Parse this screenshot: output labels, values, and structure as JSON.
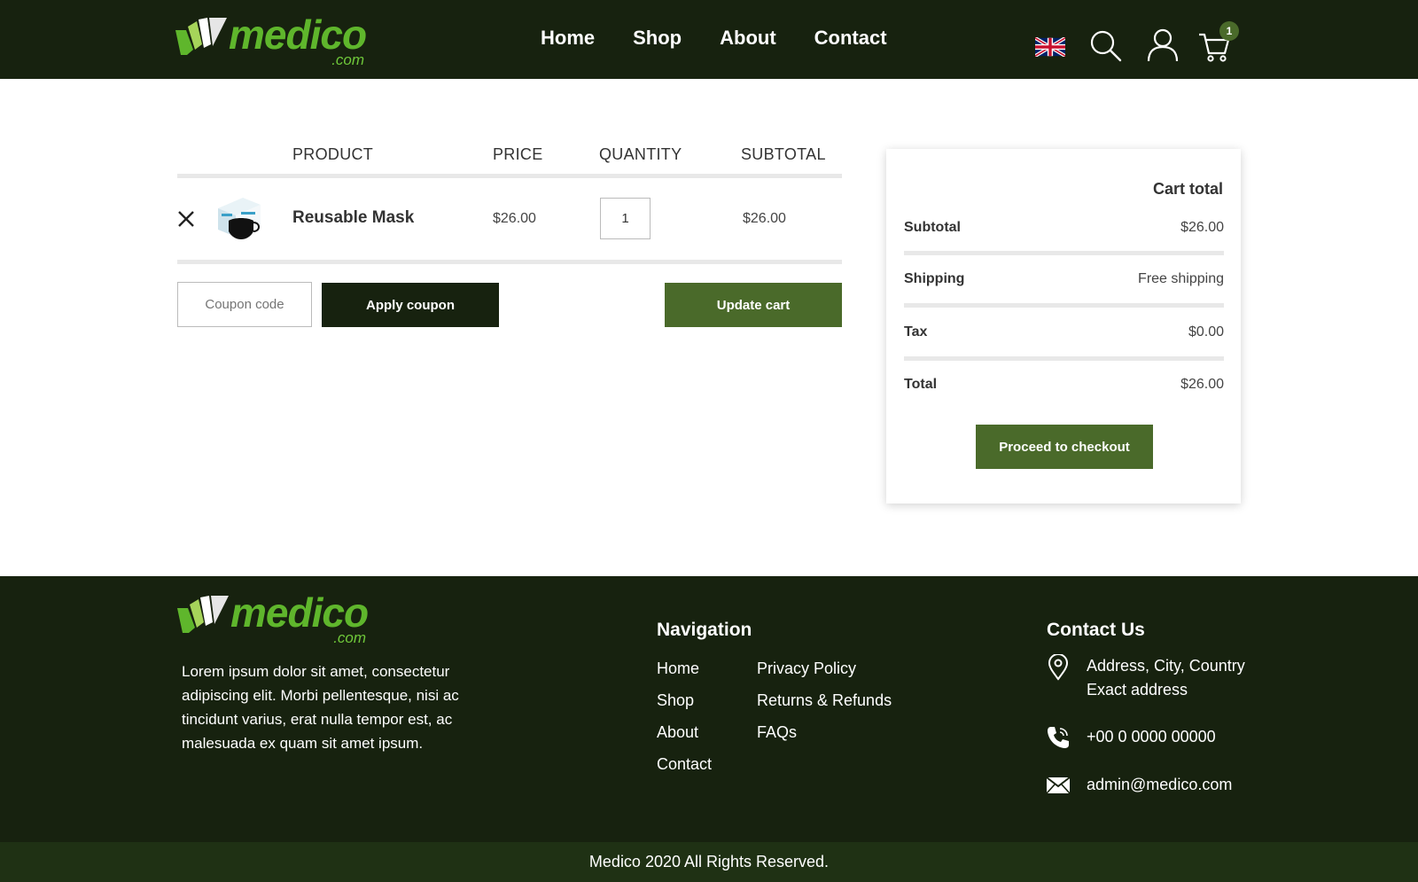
{
  "brand": {
    "word": "medico",
    "suffix": ".com"
  },
  "header": {
    "nav": [
      {
        "label": "Home"
      },
      {
        "label": "Shop"
      },
      {
        "label": "About"
      },
      {
        "label": "Contact"
      }
    ],
    "icons": [
      "uk-flag-icon",
      "search-icon",
      "user-icon",
      "cart-icon"
    ],
    "cart_count": "1"
  },
  "cart": {
    "columns": {
      "product": "PRODUCT",
      "price": "PRICE",
      "quantity": "QUANTITY",
      "subtotal": "SUBTOTAL"
    },
    "items": [
      {
        "name": "Reusable Mask",
        "price": "$26.00",
        "quantity": "1",
        "subtotal": "$26.00"
      }
    ],
    "coupon_placeholder": "Coupon code",
    "apply_label": "Apply coupon",
    "update_label": "Update cart"
  },
  "totals": {
    "title": "Cart total",
    "rows": [
      {
        "label": "Subtotal",
        "value": "$26.00"
      },
      {
        "label": "Shipping",
        "value": "Free shipping"
      },
      {
        "label": "Tax",
        "value": "$0.00"
      },
      {
        "label": "Total",
        "value": "$26.00"
      }
    ],
    "checkout_label": "Proceed to checkout"
  },
  "footer": {
    "about": "Lorem ipsum dolor sit amet, consectetur adipiscing elit. Morbi pellentesque, nisi ac tincidunt varius, erat nulla tempor est, ac malesuada ex quam sit amet ipsum.",
    "nav_title": "Navigation",
    "nav_col1": [
      "Home",
      "Shop",
      "About",
      "Contact"
    ],
    "nav_col2": [
      "Privacy Policy",
      "Returns & Refunds",
      "FAQs"
    ],
    "contact_title": "Contact Us",
    "address_line1": "Address, City, Country",
    "address_line2": "Exact address",
    "phone": "+00 0 0000 00000",
    "email": "admin@medico.com",
    "copyright": "Medico 2020 All Rights Reserved."
  },
  "colors": {
    "header_bg": "#17220f",
    "accent_green": "#4a6a2a",
    "logo_green": "#5fb62c",
    "copyright_bg": "#1f3114"
  }
}
